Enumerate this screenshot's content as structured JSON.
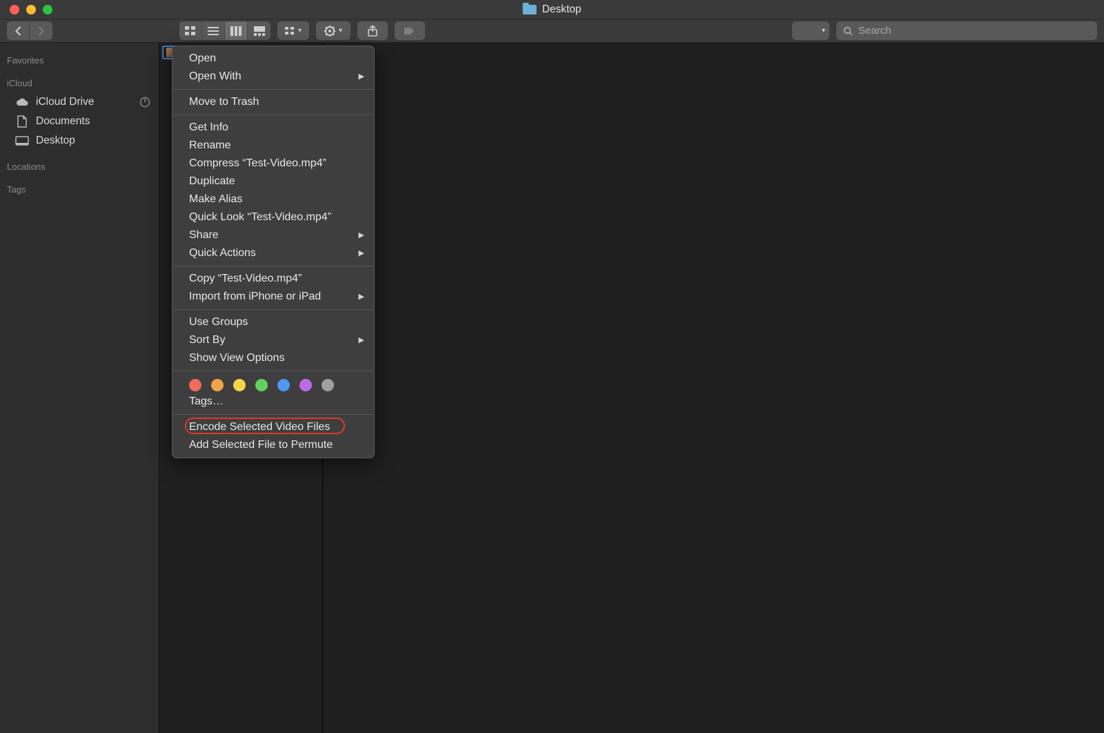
{
  "window": {
    "title": "Desktop"
  },
  "toolbar": {
    "search_placeholder": "Search"
  },
  "sidebar": {
    "sections": [
      {
        "header": "Favorites",
        "items": []
      },
      {
        "header": "iCloud",
        "items": [
          {
            "label": "iCloud Drive",
            "icon": "cloud",
            "badge": "pie"
          },
          {
            "label": "Documents",
            "icon": "doc"
          },
          {
            "label": "Desktop",
            "icon": "desktop"
          }
        ]
      },
      {
        "header": "Locations",
        "items": []
      },
      {
        "header": "Tags",
        "items": []
      }
    ]
  },
  "column": {
    "selected_file": "Test-Video.mp4"
  },
  "context_menu": {
    "groups": [
      [
        {
          "label": "Open"
        },
        {
          "label": "Open With",
          "submenu": true
        }
      ],
      [
        {
          "label": "Move to Trash"
        }
      ],
      [
        {
          "label": "Get Info"
        },
        {
          "label": "Rename"
        },
        {
          "label": "Compress “Test-Video.mp4”"
        },
        {
          "label": "Duplicate"
        },
        {
          "label": "Make Alias"
        },
        {
          "label": "Quick Look “Test-Video.mp4”"
        },
        {
          "label": "Share",
          "submenu": true
        },
        {
          "label": "Quick Actions",
          "submenu": true
        }
      ],
      [
        {
          "label": "Copy “Test-Video.mp4”"
        },
        {
          "label": "Import from iPhone or iPad",
          "submenu": true
        }
      ],
      [
        {
          "label": "Use Groups"
        },
        {
          "label": "Sort By",
          "submenu": true
        },
        {
          "label": "Show View Options"
        }
      ]
    ],
    "tag_colors": [
      "#f16a5e",
      "#f3a24a",
      "#f3d54a",
      "#61d260",
      "#4f97f0",
      "#bb6ae6",
      "#9ea0a2"
    ],
    "tags_label": "Tags…",
    "final_group": [
      {
        "label": "Encode Selected Video Files",
        "highlighted": true
      },
      {
        "label": "Add Selected File to Permute"
      }
    ]
  }
}
